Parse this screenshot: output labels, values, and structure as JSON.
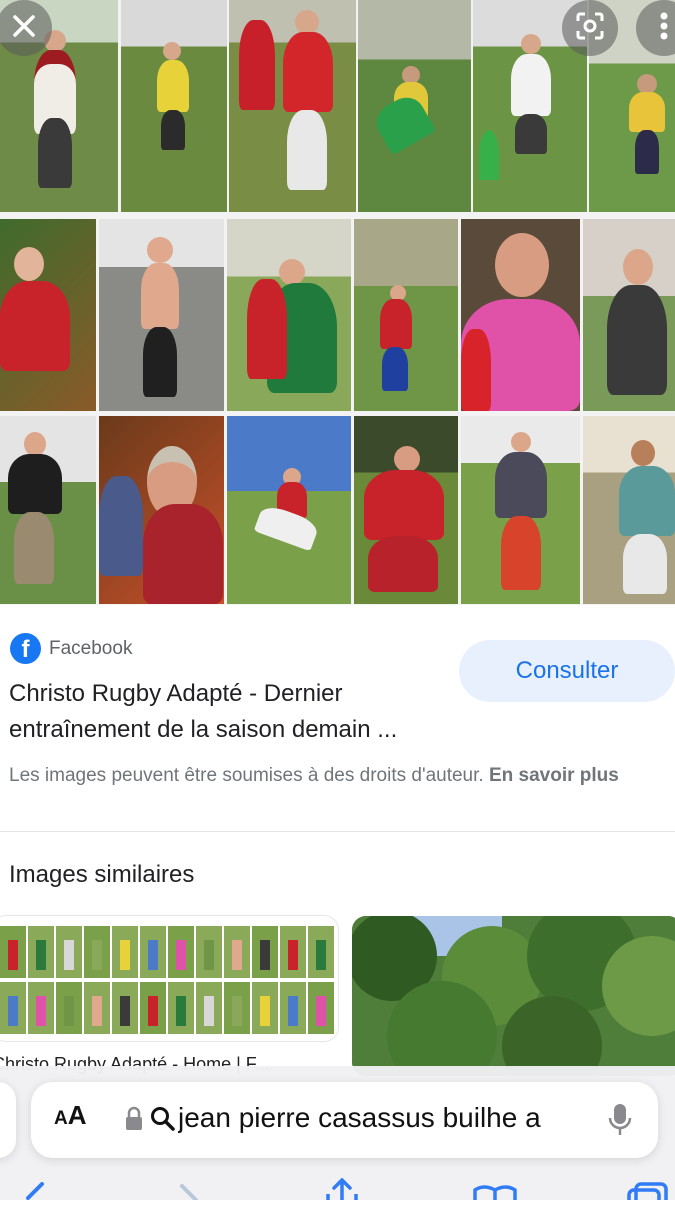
{
  "hero": {
    "close_icon": "close-icon",
    "lens_icon": "lens-icon",
    "more_icon": "more-vertical-icon"
  },
  "result": {
    "source_name": "Facebook",
    "source_logo_letter": "f",
    "consult_label": "Consulter",
    "title": "Christo Rugby Adapté - Dernier entraînement de la saison demain ...",
    "copyright_text": "Les images peuvent être soumises à des droits d'auteur. ",
    "copyright_link": "En savoir plus"
  },
  "similar": {
    "heading": "Images similaires",
    "card1_caption": "Christo Rugby Adapté - Home | F..."
  },
  "browser": {
    "aa_label_small": "A",
    "aa_label_big": "A",
    "url": "jean pierre casassus builhe a",
    "lock_icon": "lock-icon",
    "search_icon": "search-icon",
    "mic_icon": "microphone-icon",
    "toolbar_icons": [
      "back-icon",
      "forward-icon",
      "share-icon",
      "bookmarks-icon",
      "tabs-icon"
    ]
  },
  "colors": {
    "accent": "#1a73e8",
    "consult_bg": "#e8f0fe",
    "facebook": "#1877f2",
    "toolbar_icon": "#2f7cf6"
  }
}
